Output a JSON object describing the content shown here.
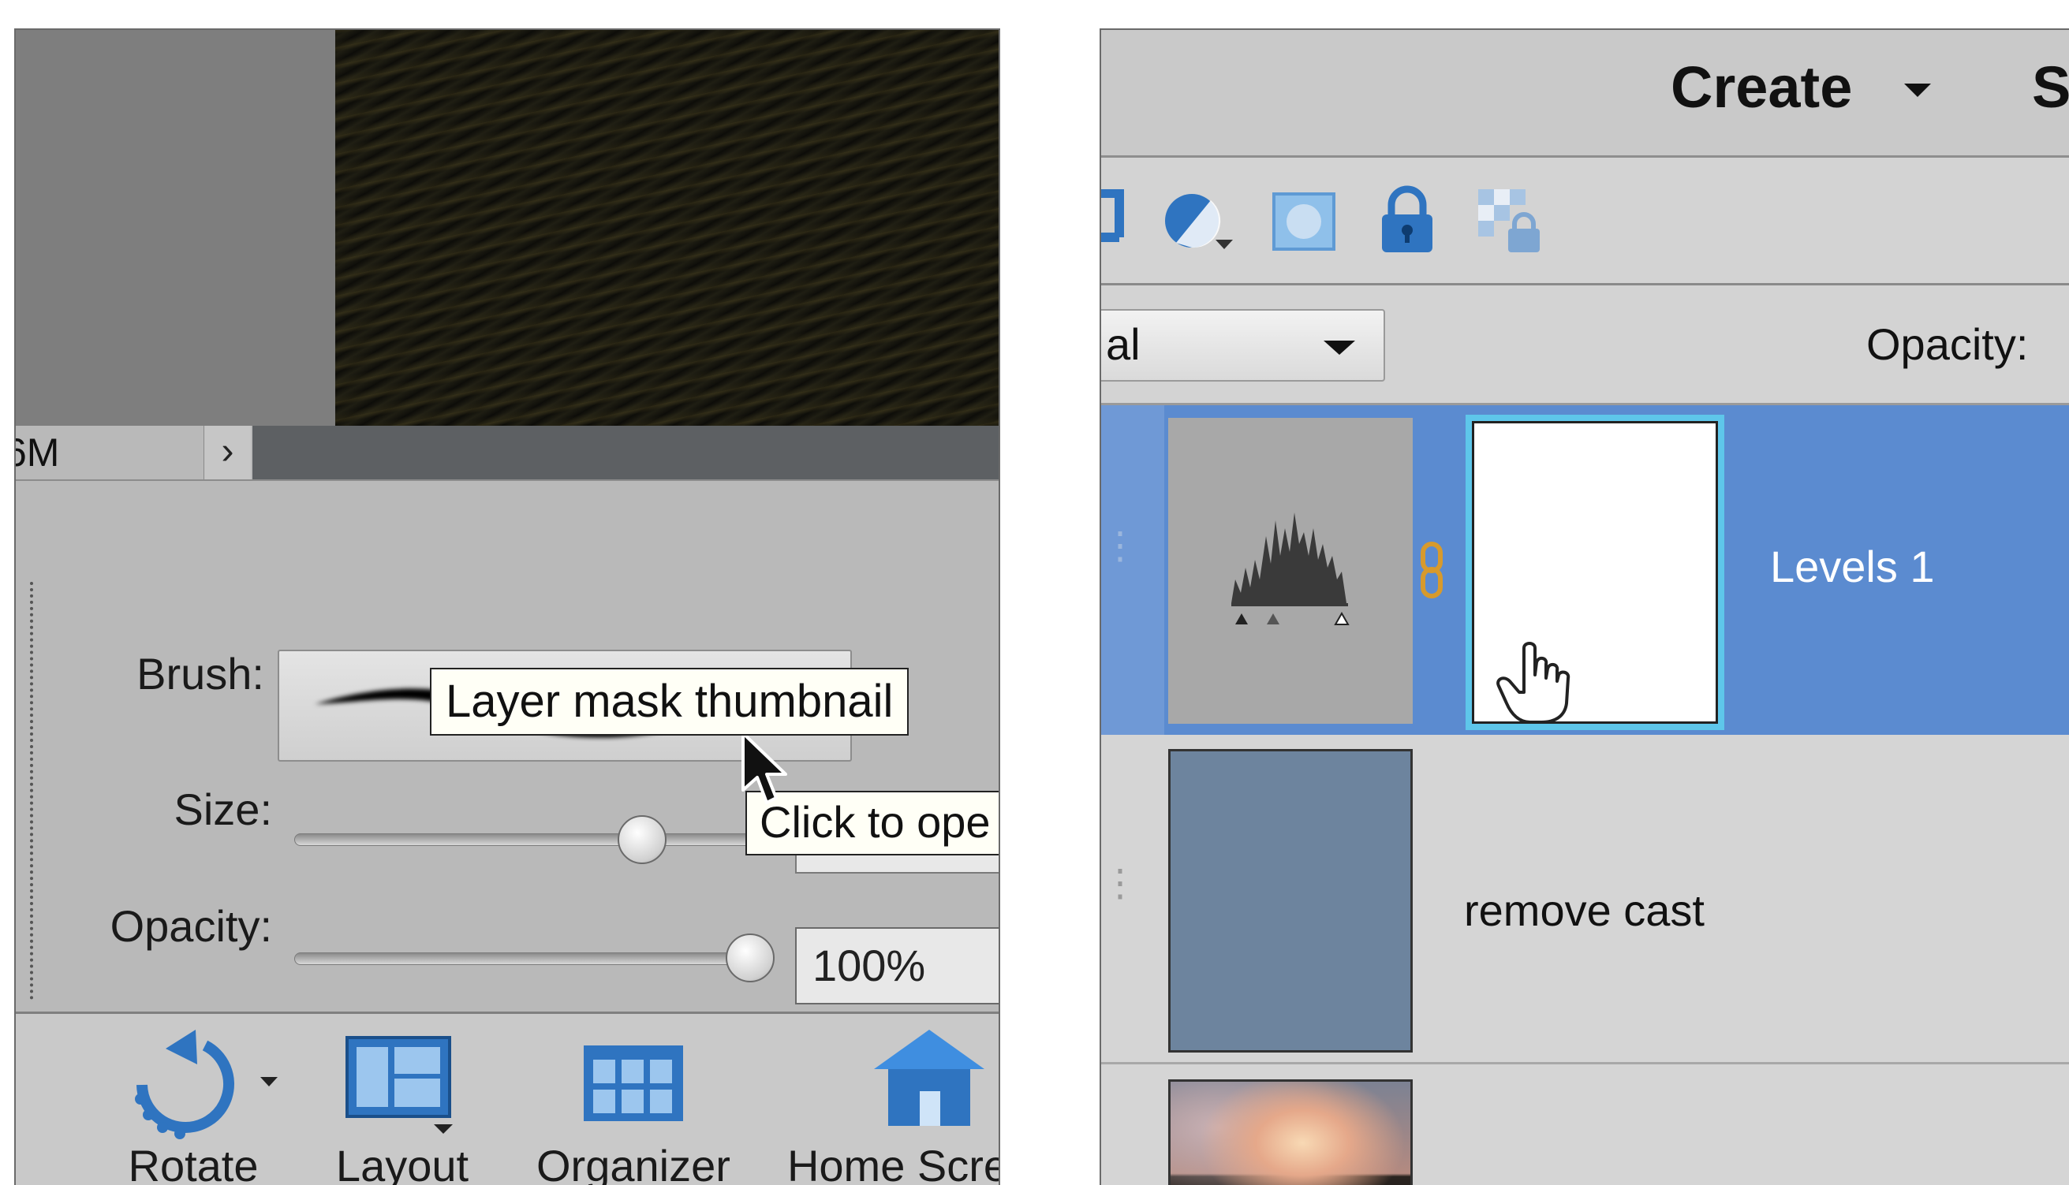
{
  "left_panel": {
    "status": {
      "zoom_text": "6M",
      "arrow_glyph": "›"
    },
    "options": {
      "brush_label": "Brush:",
      "size_label": "Size:",
      "opacity_label": "Opacity:",
      "opacity_value": "100%",
      "size_level_percent": 40,
      "opacity_level_percent": 100
    },
    "tooltip": "Click to ope",
    "taskbar": {
      "items": [
        {
          "label": "Rotate",
          "icon": "rotate-icon"
        },
        {
          "label": "Layout",
          "icon": "layout-icon"
        },
        {
          "label": "Organizer",
          "icon": "organizer-icon"
        },
        {
          "label": "Home Scre",
          "icon": "home-icon"
        }
      ]
    }
  },
  "right_panel": {
    "mode_bar": {
      "create_label": "Create",
      "share_label": "S"
    },
    "toolbar_icons": [
      "new-layer-icon",
      "adjustment-layer-icon",
      "layer-mask-icon",
      "lock-icon",
      "lock-transparency-icon"
    ],
    "blend_mode": {
      "value": "al"
    },
    "opacity_label": "Opacity:",
    "layers": [
      {
        "name": "Levels 1",
        "selected": true
      },
      {
        "name": "remove cast",
        "selected": false
      },
      {
        "name": "",
        "selected": false
      }
    ],
    "tooltip": "Layer mask thumbnail"
  },
  "colors": {
    "selection_blue": "#5b8bd0",
    "mask_highlight": "#5ec6ea",
    "icon_blue": "#2f74c0"
  }
}
